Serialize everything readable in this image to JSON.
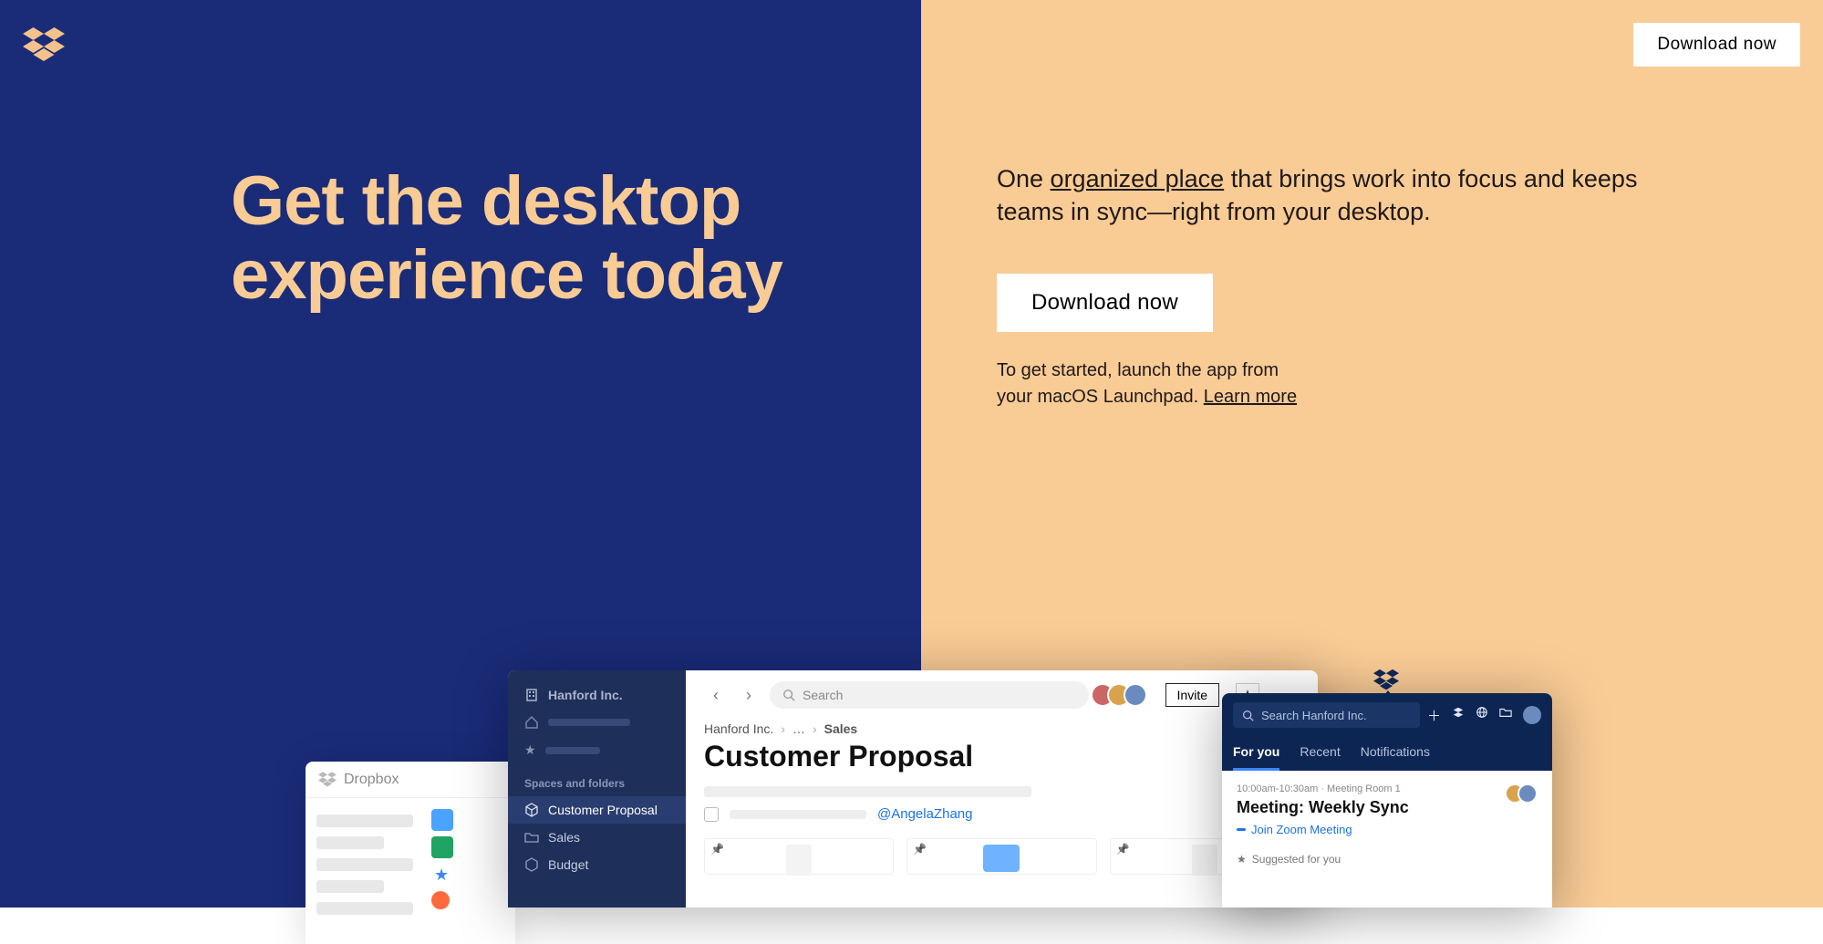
{
  "header": {
    "download_label": "Download now"
  },
  "hero": {
    "headline": "Get the desktop experience today",
    "tagline_pre": "One ",
    "tagline_link": "organized place",
    "tagline_post": " that brings work into focus and keeps teams in sync—right from your desktop.",
    "download_label": "Download now",
    "getstarted_pre": "To get started, launch the app from your macOS Launchpad. ",
    "getstarted_link": "Learn more"
  },
  "finder": {
    "title": "Dropbox"
  },
  "app": {
    "sidebar": {
      "org": "Hanford Inc.",
      "section_label": "Spaces and folders",
      "items": [
        {
          "label": "Customer Proposal",
          "active": true
        },
        {
          "label": "Sales",
          "active": false
        },
        {
          "label": "Budget",
          "active": false
        }
      ]
    },
    "search_placeholder": "Search",
    "invite_label": "Invite",
    "breadcrumb": {
      "root": "Hanford Inc.",
      "mid": "…",
      "leaf": "Sales"
    },
    "doc_title": "Customer Proposal",
    "mention": "@AngelaZhang"
  },
  "popover": {
    "search_placeholder": "Search Hanford Inc.",
    "tabs": [
      "For you",
      "Recent",
      "Notifications"
    ],
    "active_tab": 0,
    "card": {
      "meta": "10:00am-10:30am · Meeting Room 1",
      "title": "Meeting: Weekly Sync",
      "join_label": "Join Zoom Meeting"
    },
    "suggested_label": "Suggested for you"
  }
}
